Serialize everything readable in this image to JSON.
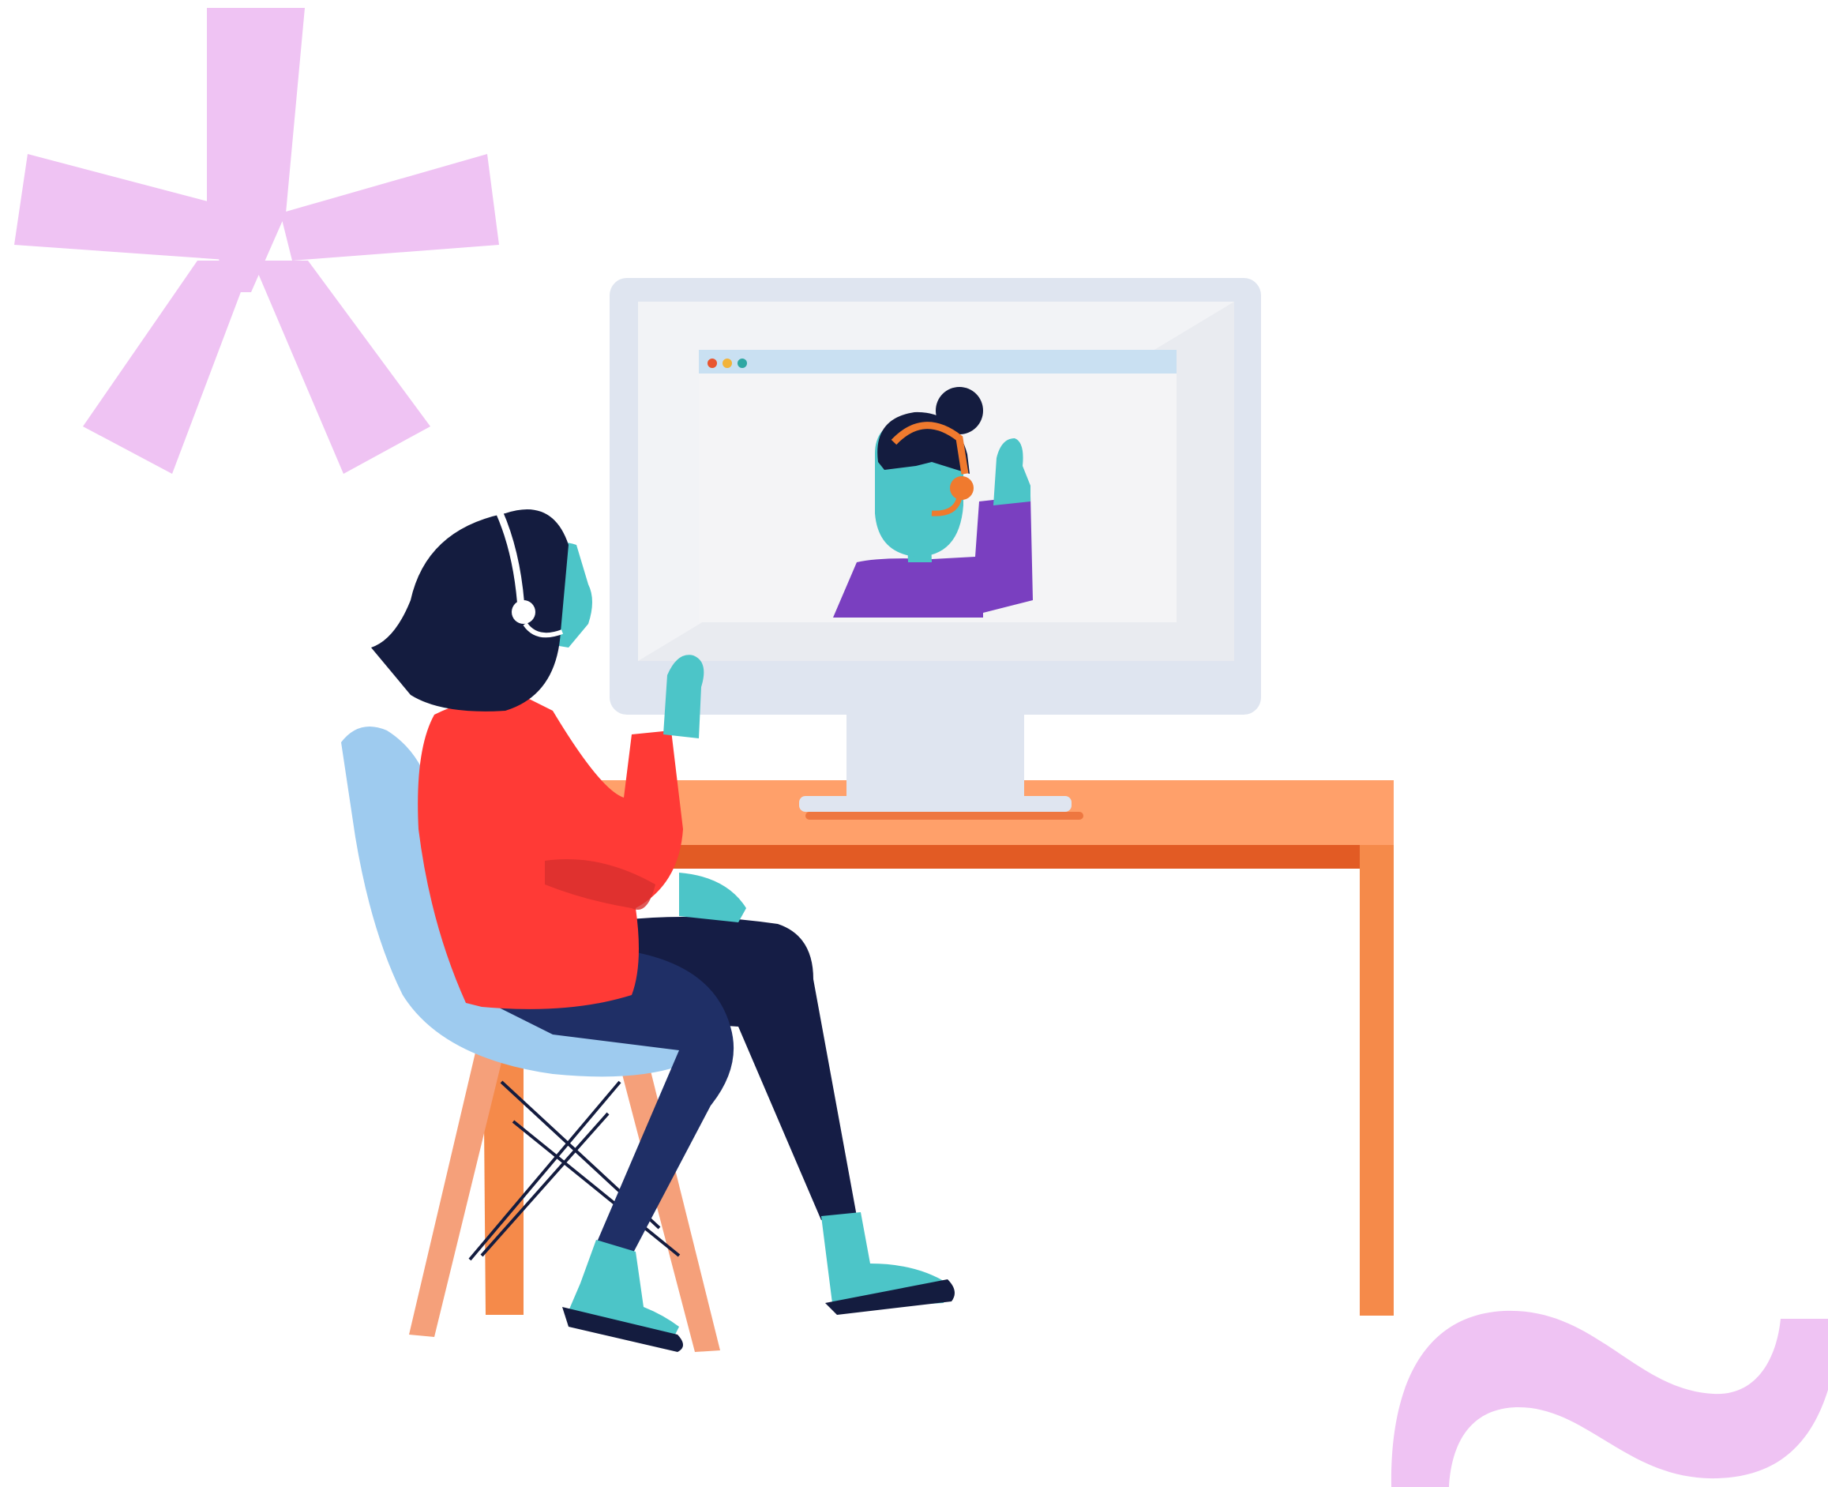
{
  "illustration": {
    "decorations": {
      "asterisk_icon": "asterisk-icon",
      "tilde_icon": "tilde-icon"
    },
    "window_dots": [
      "window-dot-red",
      "window-dot-yellow",
      "window-dot-teal"
    ]
  },
  "colors": {
    "background": "#ffffff",
    "decoration_pink": "#efc3f3",
    "monitor_frame": "#dfe5f0",
    "monitor_screen": "#f2f3f6",
    "window_titlebar": "#c9e0f2",
    "dot_red": "#e8552f",
    "dot_yellow": "#f2b33a",
    "dot_teal": "#2fa7a3",
    "skin_teal": "#4cc5c8",
    "hair_navy": "#141c3f",
    "headset_orange": "#f07a2e",
    "shirt_purple": "#7a3fc0",
    "sweater_red": "#ff3a36",
    "pants_navy": "#1f2f66",
    "pants_dark": "#151d45",
    "chair_blue": "#9ecbef",
    "chair_legs": "#f5a07a",
    "desk_top": "#ffa06a",
    "desk_edge": "#e25b24",
    "desk_leg": "#f58a4a"
  }
}
